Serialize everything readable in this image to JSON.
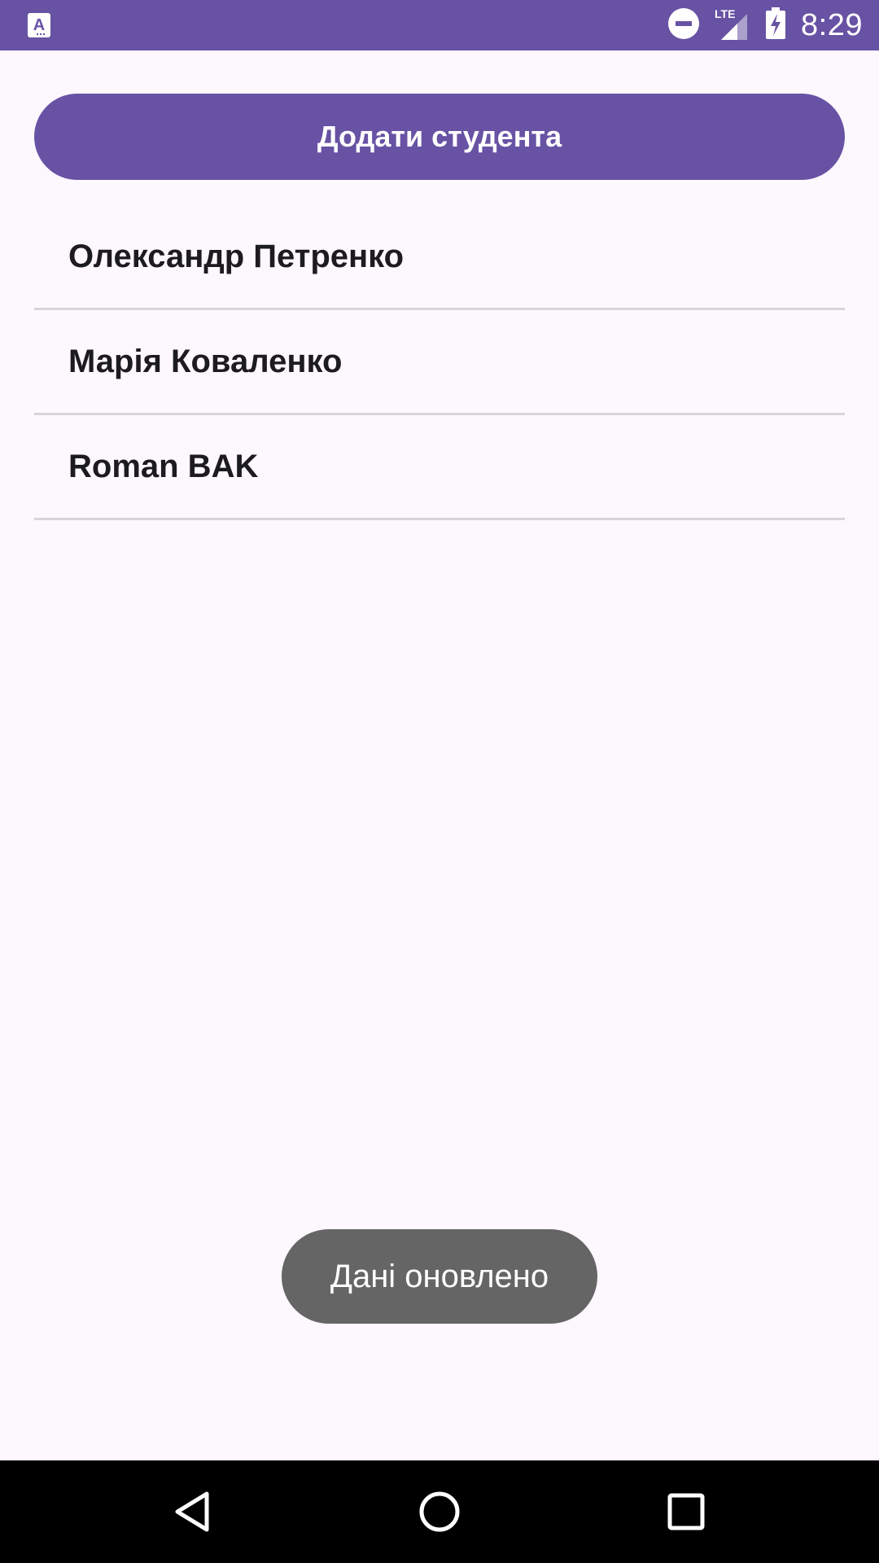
{
  "status_bar": {
    "time": "8:29",
    "network_label": "LTE",
    "icons": [
      "app-notification-icon",
      "do-not-disturb-icon",
      "lte-signal-icon",
      "battery-charging-icon"
    ],
    "background_color": "#6852A4"
  },
  "main": {
    "add_button_label": "Додати студента",
    "students": [
      {
        "name": "Олександр Петренко"
      },
      {
        "name": "Марія Коваленко"
      },
      {
        "name": "Roman BAK"
      }
    ]
  },
  "toast": {
    "message": "Дані оновлено"
  },
  "nav_bar": {
    "icons": [
      "back-icon",
      "home-icon",
      "recents-icon"
    ]
  },
  "colors": {
    "accent": "#6852A4",
    "background": "#FDF7FE",
    "divider": "#D8D5DA",
    "text_primary": "#1C1B1F",
    "toast_bg": "#656565"
  }
}
